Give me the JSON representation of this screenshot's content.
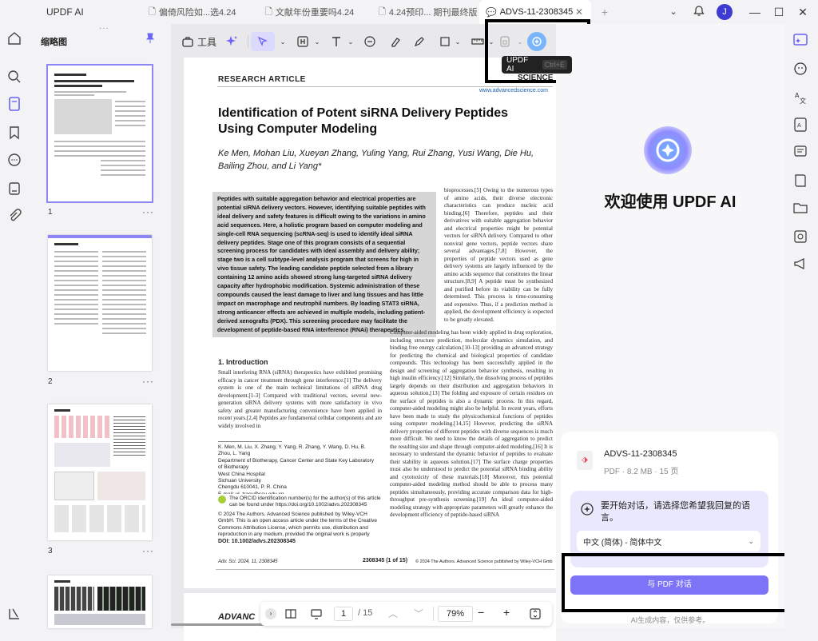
{
  "titlebar": {
    "app_name": "UPDF AI",
    "tabs": [
      {
        "label": "偏倚风险如...选4.24"
      },
      {
        "label": "文献年份重要吗4.24"
      },
      {
        "label": "4.24预印... 期刊最终版"
      },
      {
        "label": "ADVS-11-2308345"
      }
    ],
    "avatar_letter": "J"
  },
  "thumbnails": {
    "title": "缩略图",
    "pages": [
      "1",
      "2",
      "3"
    ]
  },
  "toolbar": {
    "tools_label": "工具",
    "ai_tooltip": "UPDF AI",
    "ai_shortcut": "Ctrl+E"
  },
  "document": {
    "article_type": "RESEARCH ARTICLE",
    "journal_name": "SCIENCE",
    "journal_url": "www.advancedscience.com",
    "title": "Identification of Potent siRNA Delivery Peptides Using Computer Modeling",
    "authors": "Ke Men, Mohan Liu, Xueyan Zhang, Yuling Yang, Rui Zhang, Yusi Wang, Die Hu, Bailing Zhou, and Li Yang*",
    "abstract": "Peptides with suitable aggregation behavior and electrical properties are potential siRNA delivery vectors. However, identifying suitable peptides with ideal delivery and safety features is difficult owing to the variations in amino acid sequences. Here, a holistic program based on computer modeling and single-cell RNA sequencing (scRNA-seq) is used to identify ideal siRNA delivery peptides. Stage one of this program consists of a sequential screening process for candidates with ideal assembly and delivery ability; stage two is a cell subtype-level analysis program that screens for high in vivo tissue safety. The leading candidate peptide selected from a library containing 12 amino acids showed strong lung-targeted siRNA delivery capacity after hydrophobic modification. Systemic administration of these compounds caused the least damage to liver and lung tissues and has little impact on macrophage and neutrophil numbers. By loading STAT3 siRNA, strong anticancer effects are achieved in multiple models, including patient-derived xenografts (PDX). This screening procedure may facilitate the development of peptide-based RNA interference (RNAi) therapeutics.",
    "intro_heading": "1. Introduction",
    "intro_text": "Small interfering RNA (siRNA) therapeutics have exhibited promising efficacy in cancer treatment through gene interference.[1] The delivery system is one of the main technical limitations of siRNA drug development.[1-3] Compared with traditional vectors, several new-generation siRNA delivery systems with more satisfactory in vivo safety and greater manufacturing convenience have been applied in recent years.[2,4] Peptides are fundamental cellular components and are widely involved in",
    "right_col_1": "bioprocesses.[5] Owing to the numerous types of amino acids, their diverse electronic characteristics can produce nucleic acid binding.[6] Therefore, peptides and their derivatives with suitable aggregation behavior and electrical properties might be potential vectors for siRNA delivery. Compared to other nonviral gene vectors, peptide vectors share several advantages.[7,8] However, the properties of peptide vectors used as gene delivery systems are largely influenced by the amino acids sequence that constitutes the linear structure.[8,9] A peptide must be synthesized and purified before its viability can be fully determined. This process is time-consuming and expensive. Thus, if a prediction method is applied, the development efficiency is expected to be greatly elevated.",
    "right_col_2": "Computer-aided modeling has been widely applied in drug exploration, including structure prediction, molecular dynamics simulation, and binding free energy calculation.[10-13] providing an advanced strategy for predicting the chemical and biological properties of candidate compounds. This technology has been successfully applied in the design and screening of aggregation behavior synthesis, resulting in high insulin efficiency.[12] Similarly, the dissolving process of peptides largely depends on their distribution and aggregation behaviors in aqueous solution.[13] The folding and exposure of certain residues on the surface of peptides is also a dynamic process. In this regard, computer-aided modeling might also be helpful. In recent years, efforts have been made to study the physicochemical functions of peptides using computer modeling.[14,15] However, predicting the siRNA delivery properties of different peptides with diverse sequences is much more difficult. We need to know the details of aggregation to predict the resulting size and shape through computer-aided modeling.[16] It is necessary to understand the dynamic behavior of peptides to evaluate their stability in aqueous solution.[17] The surface charge properties must also be understood to predict the potential siRNA binding ability and cytotoxicity of these materials.[18] Moreover, this potential computer-aided modeling method should be able to process many peptides simultaneously, providing accurate comparison data for high-throughput pre-synthesis screening.[19] An ideal computer-aided modeling strategy with appropriate parameters will greatly enhance the development efficiency of peptide-based siRNA",
    "affiliation": "K. Men, M. Liu, X. Zhang, Y. Yang, R. Zhang, Y. Wang, D. Hu, B. Zhou, L. Yang\nDepartment of Biotherapy, Cancer Center and State Key Laboratory of Biotherapy\nWest China Hospital\nSichuan University\nChengdu 610041, P. R. China\nE-mail: yl_tracy@scu.edu.cn",
    "orcid_note": "The ORCID identification number(s) for the author(s) of this article can be found under https://doi.org/10.1002/advs.202308345",
    "copyright": "© 2024 The Authors. Advanced Science published by Wiley-VCH GmbH. This is an open access article under the terms of the Creative Commons Attribution License, which permits use, distribution and reproduction in any medium, provided the original work is properly cited.",
    "doi": "DOI: 10.1002/advs.202308345",
    "footer_left": "Adv. Sci. 2024, 11, 2308345",
    "footer_mid": "2308345 (1 of 15)",
    "footer_right": "© 2024 The Authors. Advanced Science published by Wiley-VCH GmbH",
    "page2_header": "ADVANC"
  },
  "page_toolbar": {
    "current_page": "1",
    "total_pages": "/ 15",
    "zoom": "79%"
  },
  "ai_panel": {
    "welcome": "欢迎使用 UPDF AI",
    "file_name": "ADVS-11-2308345",
    "file_meta": "PDF · 8.2 MB · 15 页",
    "language_prompt": "要开始对话，请选择您希望我回复的语言。",
    "language_value": "中文 (简体) - 简体中文",
    "chat_button": "与 PDF 对话",
    "disclaimer": "AI生成内容，仅供参考。"
  },
  "colors": {
    "accent": "#6b63f5",
    "button": "#7c73f7",
    "selection": "#8e86f5"
  }
}
